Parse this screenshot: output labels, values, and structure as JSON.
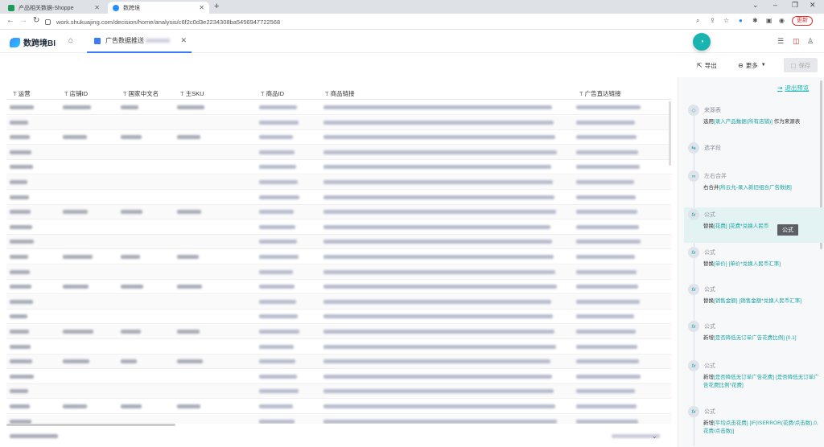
{
  "browser": {
    "tabs": [
      {
        "title": "产品相关数据-Shoppe"
      },
      {
        "title": "数跨境"
      }
    ],
    "new_tab": "+",
    "url": "work.shukuajing.com/decision/home/analysis/c6f2c0d3e2234308ba5456947722568",
    "update_label": "更新",
    "win_min": "–",
    "win_max": "❐",
    "win_close": "✕",
    "chevron": "⌄"
  },
  "app": {
    "logo_text": "数跨境BI",
    "tab_title": "广告数据推送",
    "toolbar": {
      "export_label": "导出",
      "more_label": "更多",
      "save_label": "保存"
    }
  },
  "table": {
    "columns": [
      {
        "label": "运营",
        "type_icon": "T"
      },
      {
        "label": "店铺ID",
        "type_icon": "T"
      },
      {
        "label": "国家中文名",
        "type_icon": "T"
      },
      {
        "label": "主SKU",
        "type_icon": "T"
      },
      {
        "label": "商品ID",
        "type_icon": "T"
      },
      {
        "label": "商品链接",
        "type_icon": "T"
      },
      {
        "label": "广告直达链接",
        "type_icon": "T"
      }
    ],
    "row_count": 22
  },
  "panel": {
    "exit_preview": "退出预览",
    "tooltip": "公式",
    "steps": [
      {
        "icon": "◇",
        "title": "来源表",
        "desc_parts": [
          [
            "选用",
            false
          ],
          [
            "[录入产品数据(所有店铺)]",
            true
          ],
          [
            " 作为来源表",
            false
          ]
        ]
      },
      {
        "icon": "⇆",
        "title": "选字段",
        "desc_parts": []
      },
      {
        "icon": "∞",
        "title": "左右合并",
        "desc_parts": [
          [
            "右合并",
            false
          ],
          [
            "[所云允-录入新旧组合广告数据]",
            true
          ]
        ]
      },
      {
        "icon": "fx",
        "title": "公式",
        "desc_parts": [
          [
            "替换",
            false
          ],
          [
            "[花费]",
            true
          ],
          [
            " ",
            false
          ],
          [
            "[花费*兑换人民币",
            true
          ]
        ]
      },
      {
        "icon": "fx",
        "title": "公式",
        "desc_parts": [
          [
            "替换",
            false
          ],
          [
            "[单价]",
            true
          ],
          [
            " ",
            false
          ],
          [
            "[单价*兑换人民币汇率]",
            true
          ]
        ]
      },
      {
        "icon": "fx",
        "title": "公式",
        "desc_parts": [
          [
            "替换",
            false
          ],
          [
            "[销售金额]",
            true
          ],
          [
            " ",
            false
          ],
          [
            "[销售金额*兑换人民币汇率]",
            true
          ]
        ]
      },
      {
        "icon": "fx",
        "title": "公式",
        "desc_parts": [
          [
            "新增",
            false
          ],
          [
            "[是否降低无订单广告花费比例]",
            true
          ],
          [
            " ",
            false
          ],
          [
            "[0.1]",
            true
          ]
        ]
      },
      {
        "icon": "fx",
        "title": "公式",
        "desc_parts": [
          [
            "新增",
            false
          ],
          [
            "[是否降低无订单广告花费]",
            true
          ],
          [
            " ",
            false
          ],
          [
            "[是否降低无订单广告花费比例*花费]",
            true
          ]
        ]
      },
      {
        "icon": "fx",
        "title": "公式",
        "desc_parts": [
          [
            "新增",
            false
          ],
          [
            "[平均点击花费]",
            true
          ],
          [
            " ",
            false
          ],
          [
            "[IF(ISERROR(花费/点击数),0,花费/点击数)]",
            true
          ]
        ]
      }
    ]
  }
}
